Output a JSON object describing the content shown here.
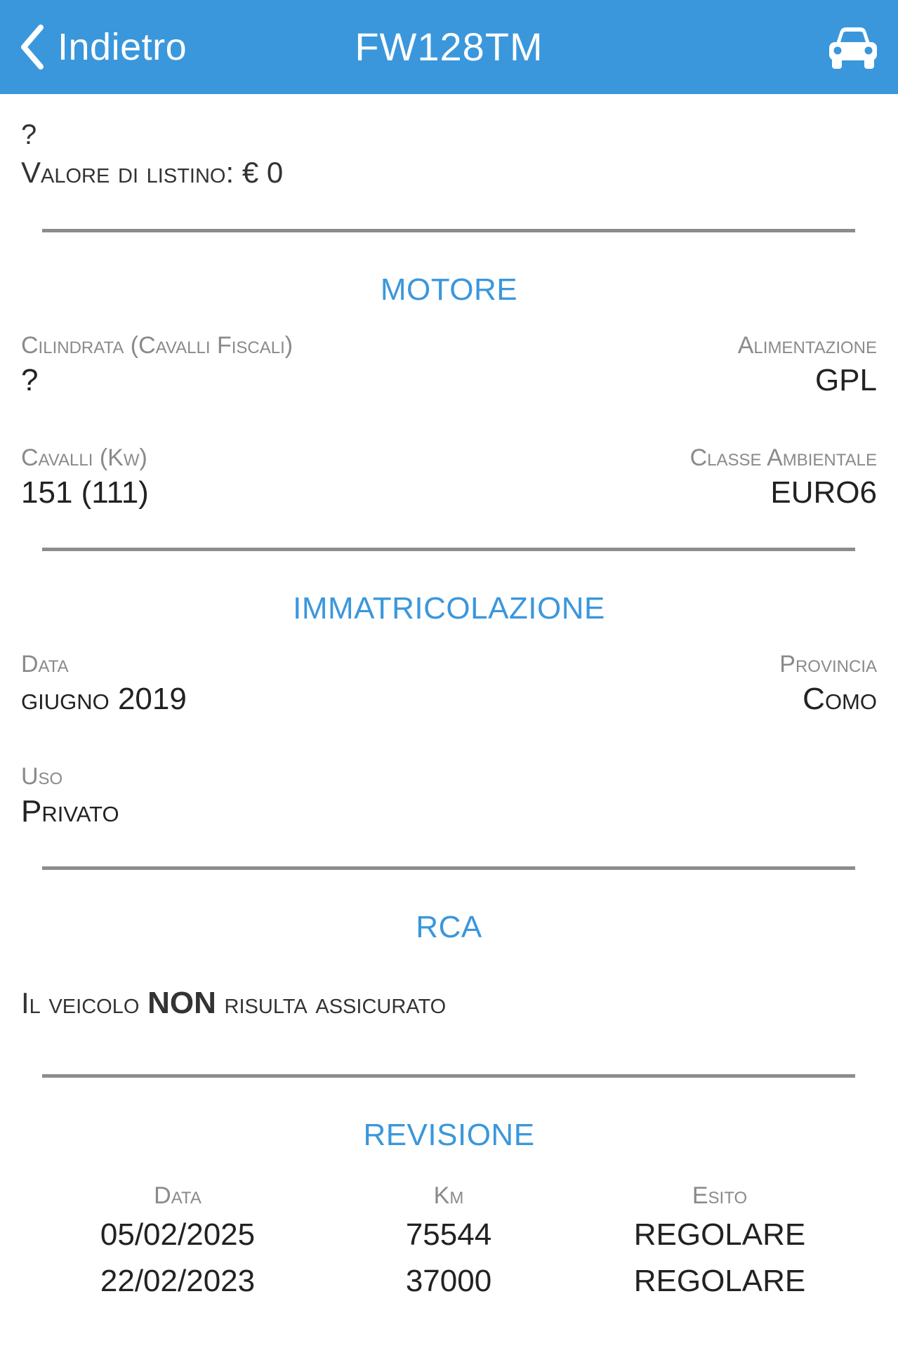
{
  "navbar": {
    "back_label": "Indietro",
    "title": "FW128TM",
    "car_icon": "car-icon",
    "back_icon": "chevron-left-icon",
    "bg_color": "#3a97dc"
  },
  "header": {
    "model": "?",
    "listino_label": "Valore di listino:",
    "listino_value": "€ 0"
  },
  "motore": {
    "title": "MOTORE",
    "cilindrata_label": "Cilindrata (Cavalli Fiscali)",
    "cilindrata_value": "?",
    "alimentazione_label": "Alimentazione",
    "alimentazione_value": "GPL",
    "cavalli_label": "Cavalli (Kw)",
    "cavalli_value": "151 (111)",
    "classe_label": "Classe Ambientale",
    "classe_value": "EURO6"
  },
  "immatricolazione": {
    "title": "IMMATRICOLAZIONE",
    "data_label": "Data",
    "data_value": "giugno 2019",
    "provincia_label": "Provincia",
    "provincia_value": "Como",
    "uso_label": "Uso",
    "uso_value": "Privato"
  },
  "rca": {
    "title": "RCA",
    "text_before": "Il veicolo",
    "text_bold": "NON",
    "text_after": "risulta assicurato"
  },
  "revisione": {
    "title": "REVISIONE",
    "columns": [
      "Data",
      "Km",
      "Esito"
    ],
    "rows": [
      [
        "05/02/2025",
        "75544",
        "REGOLARE"
      ],
      [
        "22/02/2023",
        "37000",
        "REGOLARE"
      ]
    ]
  }
}
